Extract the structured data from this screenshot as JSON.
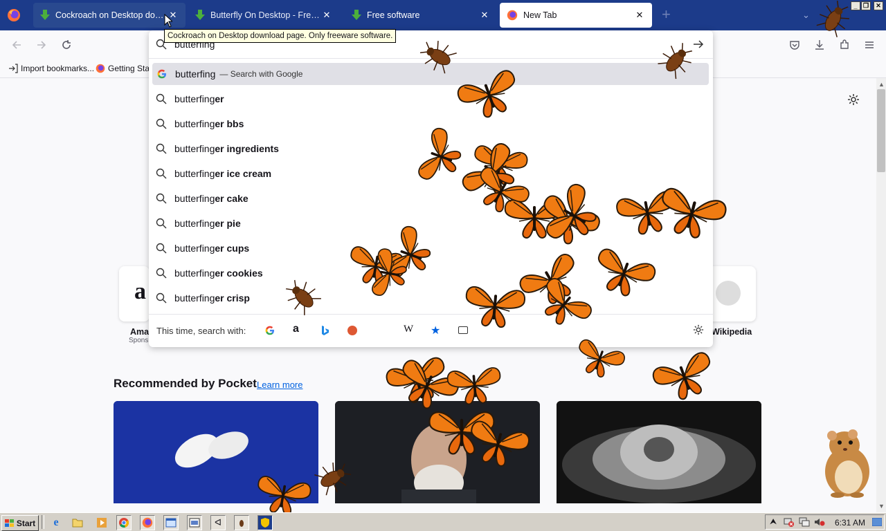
{
  "tabs": [
    {
      "title": "Cockroach on Desktop download",
      "icon": "download-arrow-icon"
    },
    {
      "title": "Butterfly On Desktop - Freeware s",
      "icon": "download-arrow-icon"
    },
    {
      "title": "Free software",
      "icon": "download-arrow-icon"
    },
    {
      "title": "New Tab",
      "icon": "firefox-icon"
    }
  ],
  "tooltip": "Cockroach on Desktop download page. Only freeware software.",
  "address": {
    "value": "butterfing"
  },
  "first_suggestion": {
    "query": "butterfing",
    "suffix": "— Search with Google"
  },
  "suggestions": [
    {
      "typed": "butterfing",
      "rest": "er"
    },
    {
      "typed": "butterfing",
      "rest": "er bbs"
    },
    {
      "typed": "butterfing",
      "rest": "er ingredients"
    },
    {
      "typed": "butterfing",
      "rest": "er ice cream"
    },
    {
      "typed": "butterfing",
      "rest": "er cake"
    },
    {
      "typed": "butterfing",
      "rest": "er pie"
    },
    {
      "typed": "butterfing",
      "rest": "er cups"
    },
    {
      "typed": "butterfing",
      "rest": "er cookies"
    },
    {
      "typed": "butterfing",
      "rest": "er crisp"
    }
  ],
  "search_with_label": "This time, search with:",
  "bookmarks": [
    {
      "label": "Import bookmarks..."
    },
    {
      "label": "Getting Sta"
    }
  ],
  "shortcuts": {
    "left_label": "Ama",
    "left_sub": "Spons",
    "right_label": "Wikipedia"
  },
  "pocket": {
    "heading": "Recommended by Pocket",
    "learn_more": "Learn more"
  },
  "taskbar": {
    "start": "Start",
    "clock": "6:31 AM"
  },
  "colors": {
    "tabstrip": "#1c3b8a",
    "accent": "#0061e0",
    "butterfly": "#f07b12"
  }
}
